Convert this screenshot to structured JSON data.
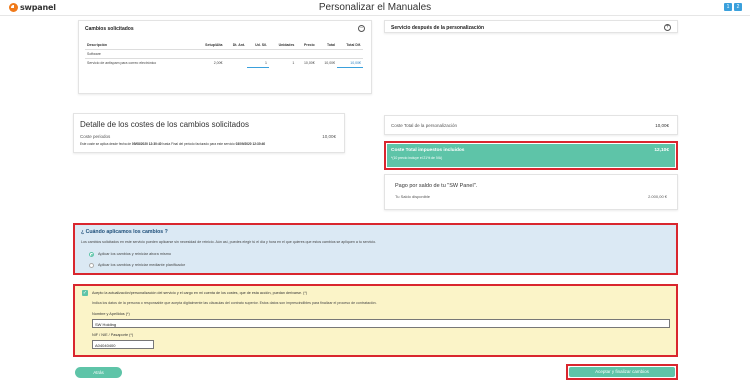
{
  "header": {
    "logo_text": "swpanel",
    "title": "Personalizar el Manuales",
    "buttons": [
      "1",
      "2"
    ]
  },
  "changes_card": {
    "title": "Cambios solicitados",
    "columns": [
      "Descripción",
      "Setup/Alta",
      "Dt. Ant.",
      "Ud. Sil.",
      "Unidades",
      "Precio",
      "Total",
      "Total Dif."
    ],
    "section": "Software",
    "row": [
      "Servicio de antispam para correo electrónico",
      "2,00€",
      "",
      "1",
      "1",
      "10,00€",
      "10,00€",
      "10,00€"
    ]
  },
  "service_card": {
    "title": "Servicio después de la personalización"
  },
  "cost_detail": {
    "title": "Detalle de los costes de los cambios solicitados",
    "label": "Coste periodos",
    "value": "10,00€",
    "note_prefix": "Este coste se aplica desde fecha de ",
    "note_date1": "05/08/2020 12:30:40",
    "note_middle": " hasta Final del periodo facturado para este servicio ",
    "note_date2": "03/09/2020 12:30:40"
  },
  "totals": {
    "personalization_label": "Coste Total de la personalización",
    "personalization_value": "10,00€",
    "taxes_label": "Coste Total impuestos incluidos",
    "taxes_value": "12,10€",
    "taxes_sub": "*(10 precio incluye el 21% de IVA)"
  },
  "payment": {
    "title": "Pago por saldo de tu \"SW Panel\".",
    "balance_label": "Tu Saldo disponible",
    "balance_value": "2.000,00 €"
  },
  "apply": {
    "title": "¿ Cuándo aplicamos los cambios ?",
    "description": "Los cambios solicitados en este servicio pueden aplicarse sin necesidad de reinicio. Aún así, puedes elegir tú el día y hora en el que quieres que estos cambios se apliquen a tu servicio.",
    "option1": "Aplicar los cambios y reiniciar ahora mismo",
    "option2": "Aplicar los cambios y reiniciar mediante planificador"
  },
  "accept": {
    "checkbox_label": "Acepto la actualización/personalización del servicio y el cargo en mi cuenta de los costes, que de esta acción, puedan derivarse. (*)",
    "instructions": "Indica los datos de la persona o responsable que acepta digitalmente las cláusulas del contrato superior. Estos datos son imprescindibles para finalizar el proceso de contratación.",
    "name_label": "Nombre y Apellidos (*)",
    "name_value": "SW Holding",
    "nif_label": "NIF / NIE / Pasaporte (*)",
    "nif_value": "A04040400"
  },
  "footer": {
    "back_label": "Atrás",
    "submit_label": "Aceptar y finalizar cambios"
  },
  "colors": {
    "accent": "#5ec4a8",
    "highlight": "#d9262e",
    "link": "#3aa0dc",
    "brand": "#f07a1a"
  }
}
